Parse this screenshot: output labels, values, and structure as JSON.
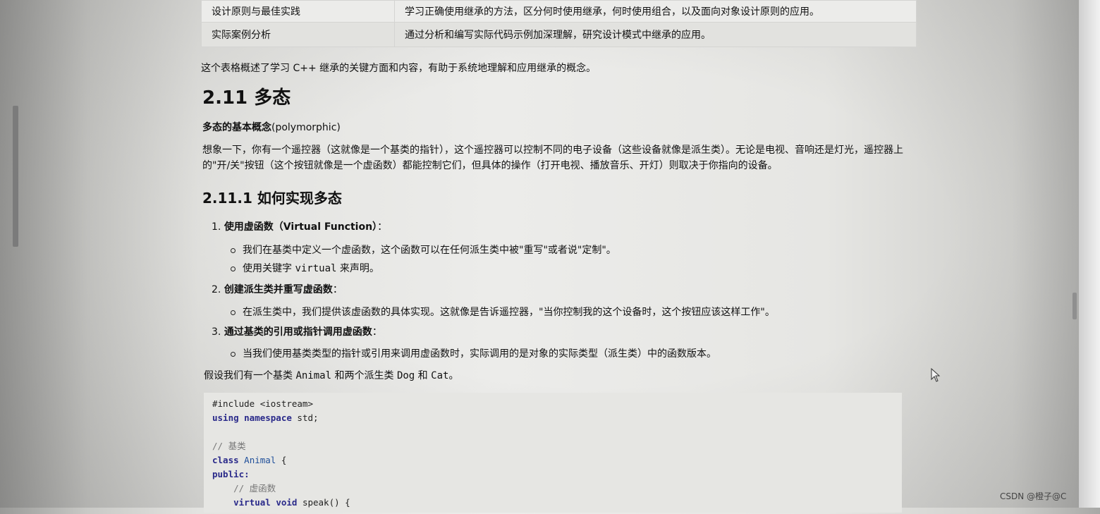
{
  "table": {
    "rows": [
      {
        "topic": "设计原则与最佳实践",
        "desc": "学习正确使用继承的方法，区分何时使用继承，何时使用组合，以及面向对象设计原则的应用。"
      },
      {
        "topic": "实际案例分析",
        "desc": "通过分析和编写实际代码示例加深理解，研究设计模式中继承的应用。"
      }
    ]
  },
  "summary": "这个表格概述了学习 C++ 继承的关键方面和内容，有助于系统地理解和应用继承的概念。",
  "section": {
    "heading": "2.11 多态",
    "concept_bold": "多态的基本概念",
    "concept_rest": "(polymorphic)",
    "paragraph": "想象一下，你有一个遥控器（这就像是一个基类的指针），这个遥控器可以控制不同的电子设备（这些设备就像是派生类）。无论是电视、音响还是灯光，遥控器上的\"开/关\"按钮（这个按钮就像是一个虚函数）都能控制它们，但具体的操作（打开电视、播放音乐、开灯）则取决于你指向的设备。"
  },
  "subsection": {
    "heading": "2.11.1 如何实现多态",
    "item1": {
      "num": "1.",
      "title": "使用虚函数（Virtual Function）",
      "suffix": "：",
      "b1": "我们在基类中定义一个虚函数，这个函数可以在任何派生类中被\"重写\"或者说\"定制\"。",
      "b2_pre": "使用关键字 ",
      "b2_code": "virtual",
      "b2_post": " 来声明。"
    },
    "item2": {
      "num": "2.",
      "title": "创建派生类并重写虚函数",
      "suffix": "：",
      "b1": "在派生类中，我们提供该虚函数的具体实现。这就像是告诉遥控器，\"当你控制我的这个设备时，这个按钮应该这样工作\"。"
    },
    "item3": {
      "num": "3.",
      "title": "通过基类的引用或指针调用虚函数",
      "suffix": "：",
      "b1": "当我们使用基类类型的指针或引用来调用虚函数时，实际调用的是对象的实际类型（派生类）中的函数版本。"
    }
  },
  "suppose": {
    "pre": "假设我们有一个基类 ",
    "c1": "Animal",
    "mid1": " 和两个派生类 ",
    "c2": "Dog",
    "mid2": " 和 ",
    "c3": "Cat",
    "post": "。"
  },
  "code": {
    "l1": "#include <iostream>",
    "l2_kw": "using namespace",
    "l2_rest": " std;",
    "l3_cm": "// 基类",
    "l4_kw": "class",
    "l4_ty": "Animal",
    "l4_rest": " {",
    "l5": "public:",
    "l6_cm": "// 虚函数",
    "l7_kw": "virtual void",
    "l7_rest": " speak() {"
  },
  "watermark": "CSDN @橙子@C"
}
